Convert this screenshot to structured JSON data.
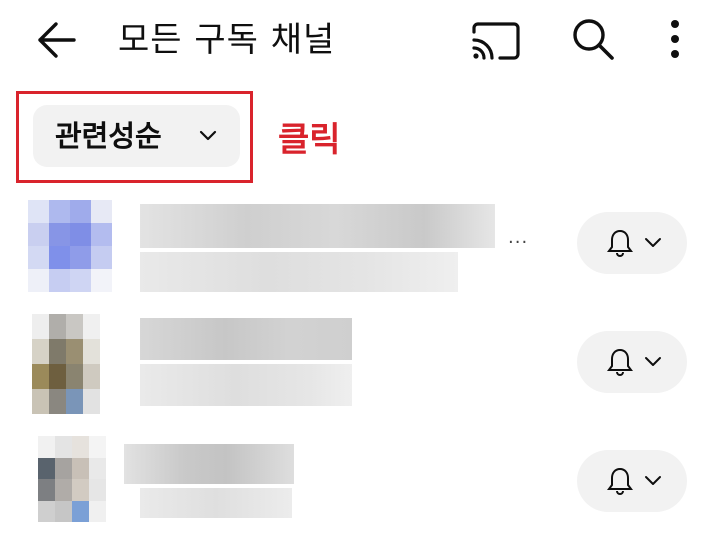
{
  "header": {
    "title": "모든 구독 채널",
    "back_icon": "arrow-left-icon",
    "cast_icon": "cast-icon",
    "search_icon": "search-icon",
    "more_icon": "more-vert-icon"
  },
  "sort": {
    "label": "관련성순",
    "icon": "chevron-down-icon"
  },
  "annotation": {
    "text": "클릭",
    "color": "#d9232c"
  },
  "channels": [
    {
      "name_hidden": true,
      "bell_icon": "bell-icon",
      "menu_icon": "chevron-down-icon"
    },
    {
      "name_hidden": true,
      "bell_icon": "bell-icon",
      "menu_icon": "chevron-down-icon"
    },
    {
      "name_hidden": true,
      "bell_icon": "bell-icon",
      "menu_icon": "chevron-down-icon"
    }
  ],
  "colors": {
    "accent": "#d9232c",
    "chip_bg": "#f2f2f2",
    "text": "#0f0f0f"
  }
}
